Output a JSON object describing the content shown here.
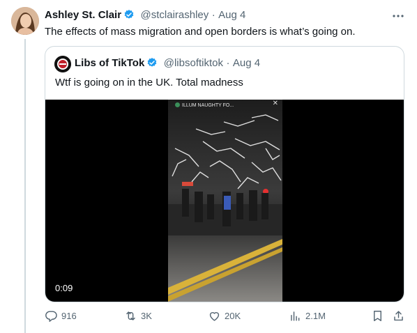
{
  "tweet": {
    "author_name": "Ashley St. Clair",
    "handle": "@stclairashley",
    "date": "Aug 4",
    "text": "The effects of mass migration and open borders is what’s going on."
  },
  "quote": {
    "author_name": "Libs of TikTok",
    "handle": "@libsoftiktok",
    "date": "Aug 4",
    "text": "Wtf is going on in the UK. Total madness",
    "video": {
      "duration": "0:09",
      "overlay_label": "ILLUM NAUGHTY FO..."
    }
  },
  "actions": {
    "replies": "916",
    "reposts": "3K",
    "likes": "20K",
    "views": "2.1M"
  },
  "icons": [
    "verified-badge-icon",
    "more-icon",
    "reply-icon",
    "repost-icon",
    "like-icon",
    "views-icon",
    "bookmark-icon",
    "share-icon"
  ],
  "colors": {
    "verified": "#1d9bf0",
    "secondary_text": "#536471",
    "border": "#cfd9de"
  }
}
